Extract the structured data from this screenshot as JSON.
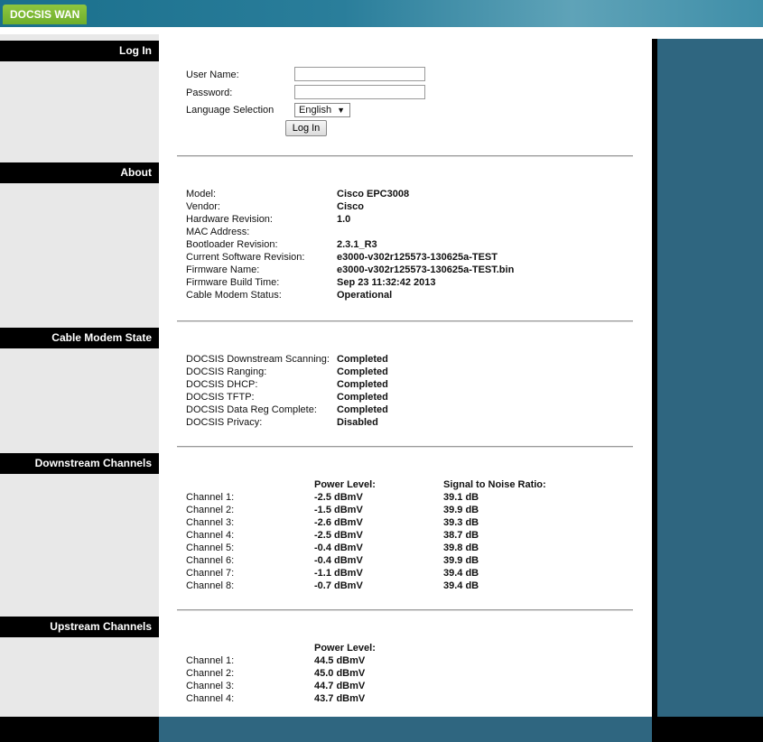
{
  "tab": "DOCSIS WAN",
  "sections": {
    "login": "Log In",
    "about": "About",
    "cable_modem_state": "Cable Modem State",
    "downstream": "Downstream Channels",
    "upstream": "Upstream Channels"
  },
  "login": {
    "username_label": "User Name:",
    "username_value": "",
    "password_label": "Password:",
    "password_value": "",
    "language_label": "Language Selection",
    "language_value": "English",
    "button": "Log In"
  },
  "about": [
    {
      "label": "Model:",
      "value": "Cisco EPC3008"
    },
    {
      "label": "Vendor:",
      "value": "Cisco"
    },
    {
      "label": "Hardware Revision:",
      "value": "1.0"
    },
    {
      "label": "MAC Address:",
      "value": ""
    },
    {
      "label": "Bootloader Revision:",
      "value": "2.3.1_R3"
    },
    {
      "label": "Current Software Revision:",
      "value": "e3000-v302r125573-130625a-TEST"
    },
    {
      "label": "Firmware Name:",
      "value": "e3000-v302r125573-130625a-TEST.bin"
    },
    {
      "label": "Firmware Build Time:",
      "value": "Sep 23 11:32:42 2013"
    },
    {
      "label": "Cable Modem Status:",
      "value": "Operational"
    }
  ],
  "state": [
    {
      "label": "DOCSIS Downstream Scanning:",
      "value": "Completed"
    },
    {
      "label": "DOCSIS Ranging:",
      "value": "Completed"
    },
    {
      "label": "DOCSIS DHCP:",
      "value": "Completed"
    },
    {
      "label": "DOCSIS TFTP:",
      "value": "Completed"
    },
    {
      "label": "DOCSIS Data Reg Complete:",
      "value": "Completed"
    },
    {
      "label": "DOCSIS Privacy:",
      "value": "Disabled"
    }
  ],
  "downstream": {
    "power_header": "Power Level:",
    "snr_header": "Signal to Noise Ratio:",
    "rows": [
      {
        "channel": "Channel 1:",
        "power": "-2.5 dBmV",
        "snr": "39.1 dB"
      },
      {
        "channel": "Channel 2:",
        "power": "-1.5 dBmV",
        "snr": "39.9 dB"
      },
      {
        "channel": "Channel 3:",
        "power": "-2.6 dBmV",
        "snr": "39.3 dB"
      },
      {
        "channel": "Channel 4:",
        "power": "-2.5 dBmV",
        "snr": "38.7 dB"
      },
      {
        "channel": "Channel 5:",
        "power": "-0.4 dBmV",
        "snr": "39.8 dB"
      },
      {
        "channel": "Channel 6:",
        "power": "-0.4 dBmV",
        "snr": "39.9 dB"
      },
      {
        "channel": "Channel 7:",
        "power": "-1.1 dBmV",
        "snr": "39.4 dB"
      },
      {
        "channel": "Channel 8:",
        "power": "-0.7 dBmV",
        "snr": "39.4 dB"
      }
    ]
  },
  "upstream": {
    "power_header": "Power Level:",
    "rows": [
      {
        "channel": "Channel 1:",
        "power": "44.5 dBmV"
      },
      {
        "channel": "Channel 2:",
        "power": "45.0 dBmV"
      },
      {
        "channel": "Channel 3:",
        "power": "44.7 dBmV"
      },
      {
        "channel": "Channel 4:",
        "power": "43.7 dBmV"
      }
    ]
  }
}
